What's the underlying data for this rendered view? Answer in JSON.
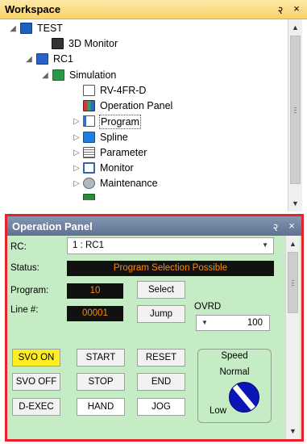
{
  "workspace": {
    "title": "Workspace",
    "pin": "२",
    "close": "×",
    "tree": [
      {
        "label": "TEST",
        "expander": "◢",
        "icon": "project-icon"
      },
      {
        "label": "3D Monitor",
        "expander": "",
        "icon": "3d-monitor-icon"
      },
      {
        "label": "RC1",
        "expander": "◢",
        "icon": "robot-controller-icon"
      },
      {
        "label": "Simulation",
        "expander": "◢",
        "icon": "simulation-icon"
      },
      {
        "label": "RV-4FR-D",
        "expander": "",
        "icon": "robot-model-icon"
      },
      {
        "label": "Operation Panel",
        "expander": "",
        "icon": "operation-panel-icon"
      },
      {
        "label": "Program",
        "expander": "▷",
        "icon": "program-icon"
      },
      {
        "label": "Spline",
        "expander": "▷",
        "icon": "spline-icon"
      },
      {
        "label": "Parameter",
        "expander": "▷",
        "icon": "parameter-icon"
      },
      {
        "label": "Monitor",
        "expander": "▷",
        "icon": "monitor-icon"
      },
      {
        "label": "Maintenance",
        "expander": "▷",
        "icon": "maintenance-icon"
      }
    ]
  },
  "operation_panel": {
    "title": "Operation Panel",
    "pin": "२",
    "close": "×",
    "rc_label": "RC:",
    "rc_value": "1 : RC1",
    "status_label": "Status:",
    "status_value": "Program Selection Possible",
    "program_label": "Program:",
    "program_value": "10",
    "line_label": "Line #:",
    "line_value": "00001",
    "select_button": "Select",
    "jump_button": "Jump",
    "ovrd_label": "OVRD",
    "ovrd_value": "100",
    "buttons": {
      "svo_on": "SVO ON",
      "svo_off": "SVO OFF",
      "d_exec": "D-EXEC",
      "start": "START",
      "stop": "STOP",
      "hand": "HAND",
      "reset": "RESET",
      "end": "END",
      "jog": "JOG"
    },
    "speed": {
      "title": "Speed",
      "mode": "Normal",
      "low": "Low"
    }
  },
  "colors": {
    "workspace_title": "#f7d36c",
    "panel_title": "#5f7190",
    "panel_bg": "#c5ecc5",
    "highlight_border": "#e8222a",
    "status_text": "#ff8a00",
    "svo_on": "#ffee22",
    "knob": "#0a16b8"
  }
}
